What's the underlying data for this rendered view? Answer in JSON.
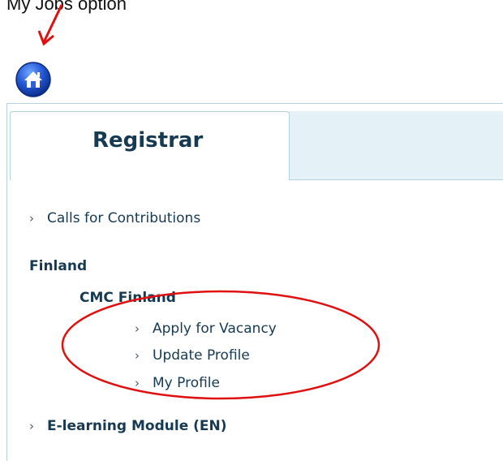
{
  "annotation_text": "My Jobs option",
  "registrar_tab": {
    "title": "Registrar"
  },
  "links": {
    "calls_for_contributions": "Calls for Contributions",
    "apply_for_vacancy": "Apply for Vacancy",
    "update_profile": "Update Profile",
    "my_profile": "My Profile",
    "elearning_module": "E-learning Module (EN)"
  },
  "sections": {
    "country": "Finland",
    "mission": "CMC Finland"
  },
  "icons": {
    "chevron": "›",
    "home": "home-icon"
  },
  "colors": {
    "tab_strip": "#e4f1f6",
    "border": "#b9d3dd",
    "text_dark": "#163a52",
    "annotation_red": "#e01010"
  }
}
